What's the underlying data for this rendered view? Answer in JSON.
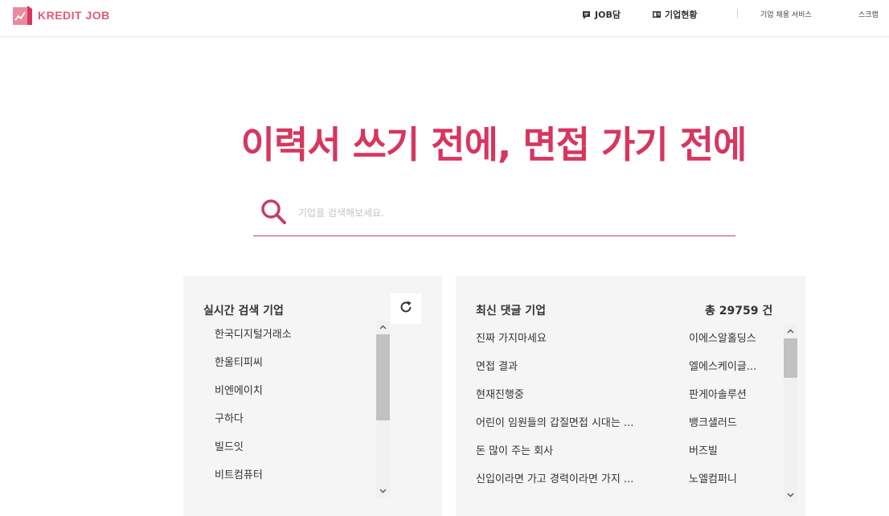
{
  "header": {
    "logo_text": "KREDIT JOB",
    "nav": [
      {
        "label": "JOB담",
        "icon": "chat-icon"
      },
      {
        "label": "기업현황",
        "icon": "company-card-icon"
      }
    ],
    "links": [
      "기업 채용 서비스",
      "스크랩"
    ]
  },
  "hero": {
    "title": "이력서 쓰기 전에, 면접 가기 전에",
    "search_placeholder": "기업을 검색해보세요."
  },
  "realtime": {
    "title": "실시간 검색 기업",
    "items": [
      "한국디지털거래소",
      "한울티피씨",
      "비엔에이치",
      "구하다",
      "빌드잇",
      "비트컴퓨터"
    ]
  },
  "comments": {
    "title": "최신 댓글 기업",
    "total": "총 29759 건",
    "rows": [
      {
        "title": "진짜 가지마세요",
        "company": "이에스알홀딩스"
      },
      {
        "title": "면접 결과",
        "company": "엘에스케이글..."
      },
      {
        "title": "현재진행중",
        "company": "판게아솔루션"
      },
      {
        "title": "어린이 임원들의 갑질면접 시대는 ...",
        "company": "뱅크샐러드"
      },
      {
        "title": "돈 많이 주는 회사",
        "company": "버즈빌"
      },
      {
        "title": "신입이라면 가고 경력이라면 가지 ...",
        "company": "노엘컴퍼니"
      }
    ]
  },
  "colors": {
    "brand": "#d6365f",
    "panel_bg": "#f5f5f5"
  }
}
